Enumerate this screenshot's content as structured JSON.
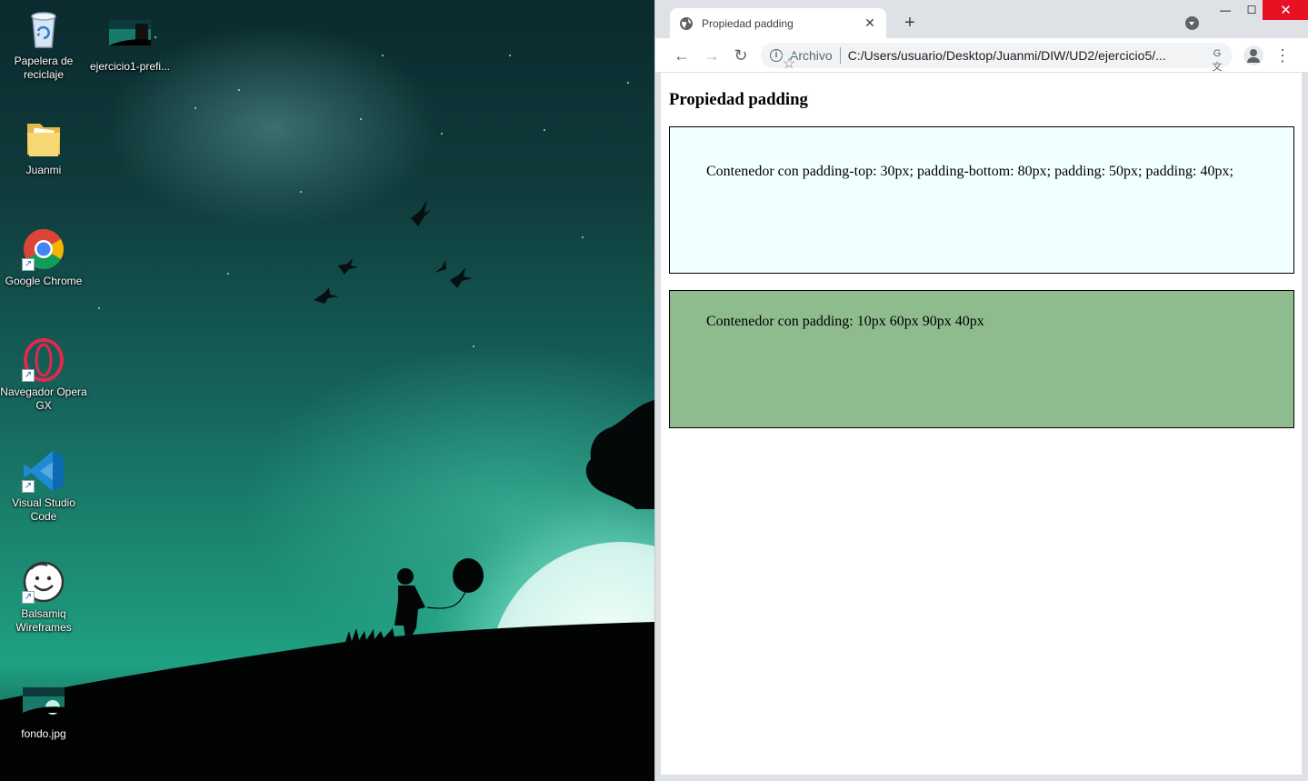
{
  "desktop": {
    "icons": [
      {
        "label": "Papelera de reciclaje",
        "icon": "recycle-bin-icon"
      },
      {
        "label": "ejercicio1-prefi...",
        "icon": "image-thumbnail-icon"
      },
      {
        "label": "Juanmi",
        "icon": "folder-icon"
      },
      {
        "label": "Google Chrome",
        "icon": "chrome-icon"
      },
      {
        "label": "Navegador Opera GX",
        "icon": "opera-gx-icon"
      },
      {
        "label": "Visual Studio Code",
        "icon": "vscode-icon"
      },
      {
        "label": "Balsamiq Wireframes",
        "icon": "balsamiq-icon"
      },
      {
        "label": "fondo.jpg",
        "icon": "image-thumbnail-icon"
      }
    ]
  },
  "browser": {
    "tab": {
      "title": "Propiedad padding",
      "close": "✕"
    },
    "new_tab": "+",
    "window_controls": {
      "minimize": "—",
      "maximize": "☐",
      "close": "✕"
    },
    "nav": {
      "back": "←",
      "forward": "→",
      "reload": "↻",
      "menu": "⋮"
    },
    "omnibox": {
      "info": "i",
      "scheme": "Archivo",
      "url": "C:/Users/usuario/Desktop/Juanmi/DIW/UD2/ejercicio5/...",
      "translate": "G文",
      "bookmark": "☆"
    }
  },
  "page": {
    "heading": "Propiedad padding",
    "box1": {
      "text": "Contenedor con padding-top: 30px; padding-bottom: 80px; padding: 50px; padding: 40px;",
      "background": "#f0ffff"
    },
    "box2": {
      "text": "Contenedor con padding: 10px 60px 90px 40px",
      "background": "#8fbc8f"
    }
  }
}
